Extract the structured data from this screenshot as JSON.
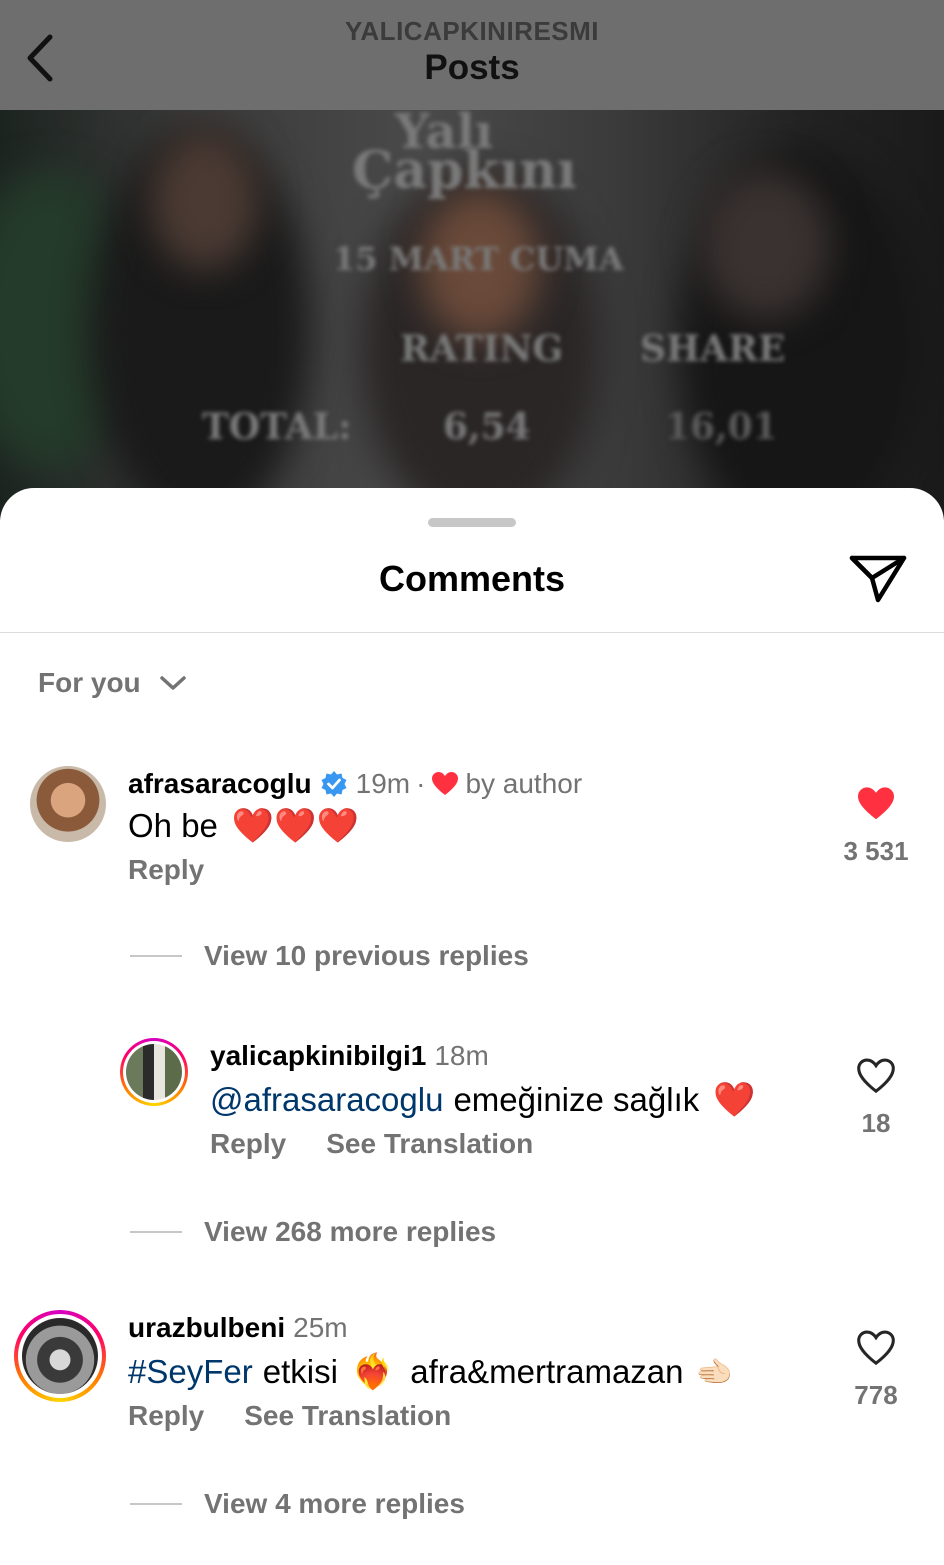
{
  "nav": {
    "account_name": "YALICAPKINIRESMI",
    "title": "Posts"
  },
  "post_image": {
    "title_line1": "Yalı",
    "title_line2": "Çapkını",
    "date": "15 MART CUMA",
    "col_rating": "RATING",
    "col_share": "SHARE",
    "row_label": "TOTAL:",
    "rating_value": "6,54",
    "share_value": "16,01"
  },
  "sheet": {
    "title": "Comments",
    "filter_label": "For you"
  },
  "comments": [
    {
      "username": "afrasaracoglu",
      "verified": true,
      "time": "19m",
      "separator": "·",
      "liked_by_author": "by author",
      "text": "Oh be",
      "emoji": "❤️❤️❤️",
      "reply_label": "Reply",
      "liked": true,
      "like_count": "3 531",
      "view_replies": "View 10 previous replies"
    },
    {
      "username": "yalicapkinibilgi1",
      "time": "18m",
      "mention": "@afrasaracoglu",
      "text": "emeğinize sağlık",
      "emoji": "❤️",
      "reply_label": "Reply",
      "translate_label": "See Translation",
      "liked": false,
      "like_count": "18",
      "view_replies": "View 268 more replies"
    },
    {
      "username": "urazbulbeni",
      "time": "25m",
      "hashtag": "#SeyFer",
      "text": "etkisi",
      "emoji": "❤️‍🔥",
      "text2": "afra&mertramazan",
      "emoji2": "🫲🏻",
      "reply_label": "Reply",
      "translate_label": "See Translation",
      "liked": false,
      "like_count": "778",
      "view_replies": "View 4 more replies"
    }
  ],
  "colors": {
    "accent_like": "#ff3040",
    "mention": "#00376b",
    "verified": "#3897f0",
    "secondary_text": "#737373"
  },
  "icons": [
    "back-chevron-icon",
    "share-send-icon",
    "chevron-down-icon",
    "verified-badge-icon",
    "heart-filled-icon",
    "heart-outline-icon"
  ]
}
